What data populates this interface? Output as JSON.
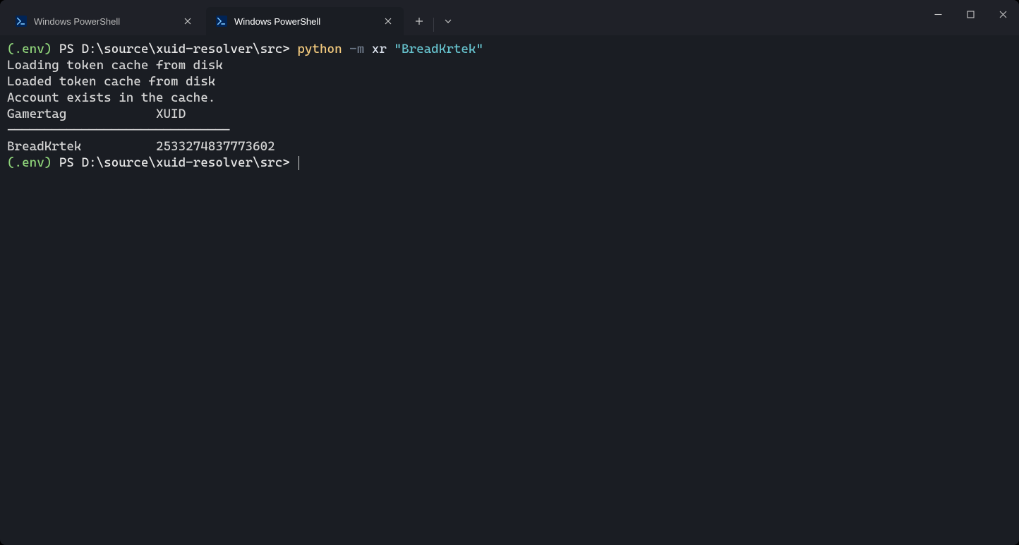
{
  "tabs": [
    {
      "title": "Windows PowerShell",
      "active": false
    },
    {
      "title": "Windows PowerShell",
      "active": true
    }
  ],
  "terminal": {
    "prompt_venv": "(.env)",
    "prompt_ps": " PS ",
    "prompt_path": "D:\\source\\xuid-resolver\\src>",
    "cmd_python": "python",
    "cmd_flag": "-m",
    "cmd_module": "xr",
    "cmd_string": "\"BreadKrtek\"",
    "out_line1": "Loading token cache from disk",
    "out_line2": "Loaded token cache from disk",
    "out_line3": "Account exists in the cache.",
    "out_header": "Gamertag            XUID",
    "out_divider": "------------------------------",
    "out_row": "BreadKrtek          2533274837773602"
  }
}
